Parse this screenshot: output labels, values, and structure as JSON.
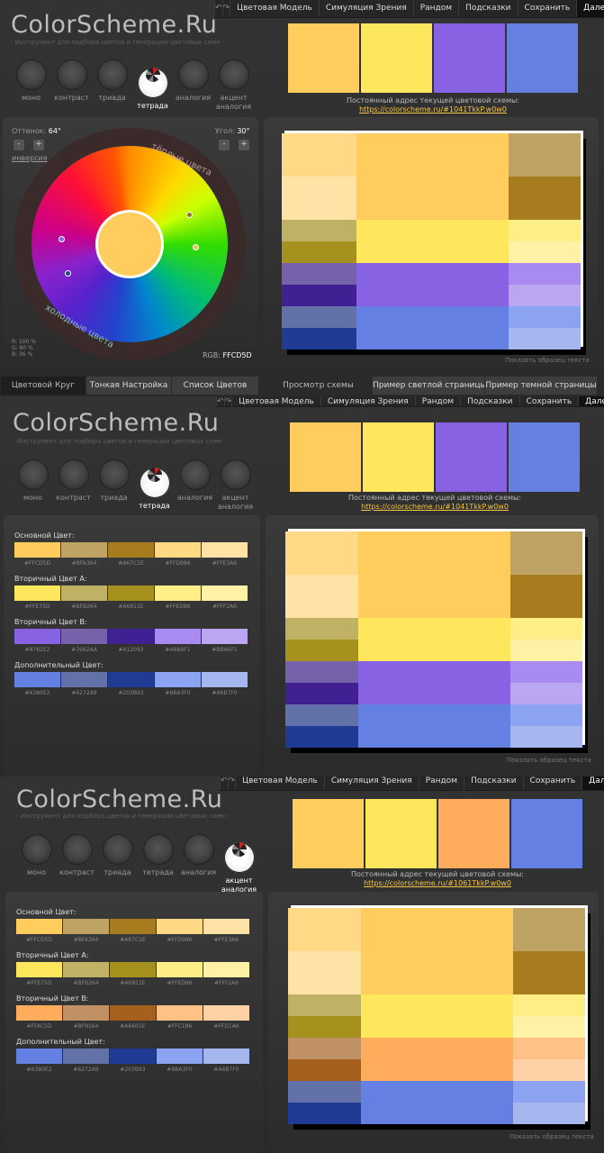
{
  "menu": {
    "undo_icon": "↶",
    "redo_icon": "↷",
    "items": [
      "Цветовая Модель",
      "Симуляция Зрения",
      "Рандом",
      "Подсказки",
      "Сохранить",
      "Далее ..."
    ]
  },
  "brand": {
    "logo": "ColorScheme.Ru",
    "slogan": "- Инструмент для подбора цветов и генерации цветовых схем -"
  },
  "modes": [
    "моно",
    "контраст",
    "триада",
    "тетрада",
    "аналогия",
    "акцент аналогия"
  ],
  "address_label": "Постоянный адрес текущей цветовой схемы:",
  "wheel": {
    "hue_label": "Оттенок:",
    "hue_value": "64°",
    "angle_label": "Угол:",
    "angle_value": "30°",
    "inverse": "инверсия",
    "warm": "тёплые цвета",
    "cold": "холодные цвета",
    "rgb_pct": [
      "R: 100 %",
      "G:  80 %",
      "B:  36 %"
    ],
    "rgb_label": "RGB:",
    "rgb_value": "FFCD5D",
    "minus": "-",
    "plus": "+"
  },
  "left_tabs": [
    "Цветовой Круг",
    "Тонкая Настройка",
    "Список Цветов"
  ],
  "right_tabs": [
    "Просмотр схемы",
    "Пример светлой страницы",
    "Пример темной страницы"
  ],
  "preview_hint": "Показать образец текста",
  "screens": [
    {
      "active_mode": "тетрада",
      "url": "https://colorscheme.ru/#1041TkkP.w0w0",
      "main": [
        "#FFCD5D",
        "#FFE75D",
        "#8762E2",
        "#6380E2"
      ]
    },
    {
      "active_mode": "тетрада",
      "url": "https://colorscheme.ru/#1041TkkP.w0w0",
      "main": [
        "#FFCD5D",
        "#FFE75D",
        "#8762E2",
        "#6380E2"
      ]
    },
    {
      "active_mode": "акцент аналогия",
      "url": "https://colorscheme.ru/#1061TkkP.w0w0",
      "main": [
        "#FFCD5D",
        "#FFE75D",
        "#FFAC5D",
        "#6380E2"
      ]
    }
  ],
  "palettes": {
    "tetrada": [
      {
        "title": "Основной Цвет:",
        "colors": [
          "#FFCD5D",
          "#BFA364",
          "#A67C1E",
          "#FFD986",
          "#FFE3A6"
        ]
      },
      {
        "title": "Вторичный Цвет А:",
        "colors": [
          "#FFE75D",
          "#BFB264",
          "#A6911E",
          "#FFED86",
          "#FFF2A6"
        ]
      },
      {
        "title": "Вторичный Цвет В:",
        "colors": [
          "#8762E2",
          "#7662AA",
          "#412093",
          "#A88AF1",
          "#BBA6F1"
        ]
      },
      {
        "title": "Дополнительный Цвет:",
        "colors": [
          "#6380E2",
          "#6272A9",
          "#203B93",
          "#8BA3F0",
          "#A6B7F0"
        ]
      }
    ],
    "accent": [
      {
        "title": "Основной Цвет:",
        "colors": [
          "#FFCD5D",
          "#BFA364",
          "#A67C1E",
          "#FFD986",
          "#FFE3A6"
        ]
      },
      {
        "title": "Вторичный Цвет А:",
        "colors": [
          "#FFE75D",
          "#BFB264",
          "#A6911E",
          "#FFED86",
          "#FFF2A6"
        ]
      },
      {
        "title": "Вторичный Цвет В:",
        "colors": [
          "#FFAC5D",
          "#BF9164",
          "#A6601E",
          "#FFC186",
          "#FFD1A6"
        ]
      },
      {
        "title": "Дополнительный Цвет:",
        "colors": [
          "#6380E2",
          "#6272A9",
          "#203B93",
          "#8BA3F0",
          "#A6B7F0"
        ]
      }
    ]
  }
}
